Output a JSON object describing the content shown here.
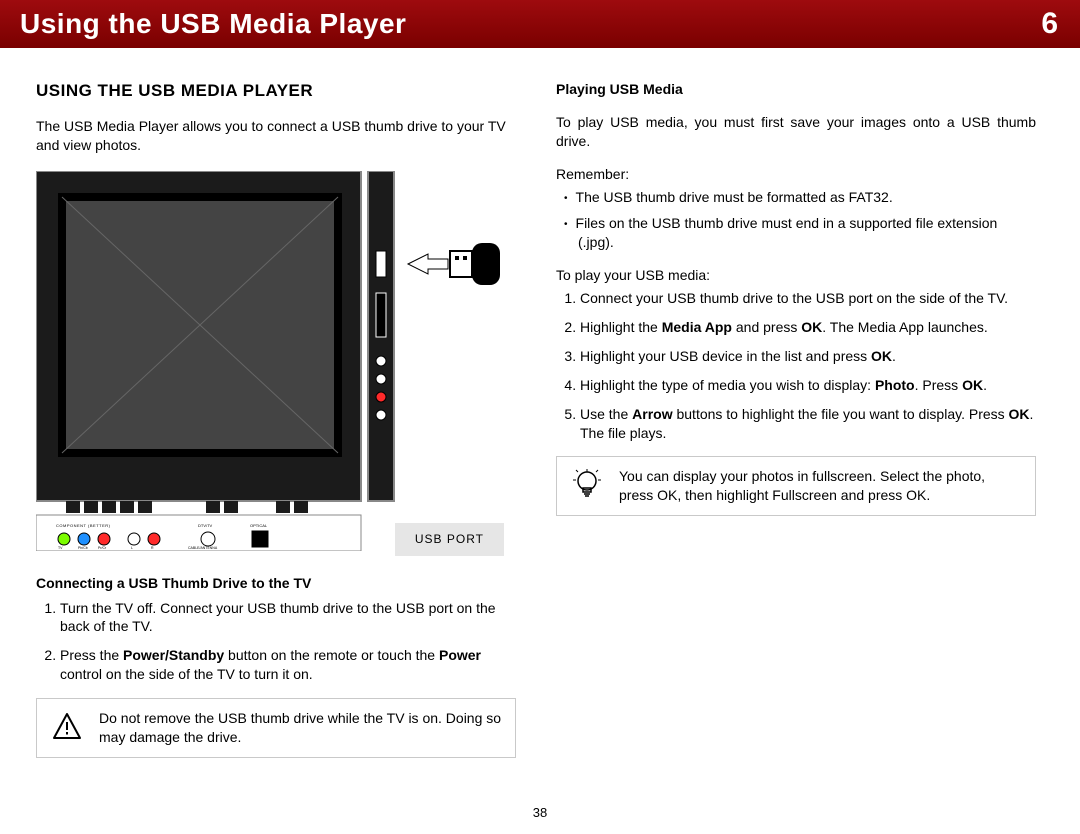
{
  "header": {
    "title": "Using the USB Media Player",
    "chapter": "6"
  },
  "left": {
    "section_title": "USING THE USB MEDIA PLAYER",
    "intro": "The USB Media Player allows you to connect a USB thumb drive to your TV and view photos.",
    "illustration_label": "USB PORT",
    "connect_heading": "Connecting a USB Thumb Drive to the TV",
    "connect_steps": [
      "Turn the TV off. Connect your USB thumb drive to the USB port on the back of the TV.",
      {
        "pre": "Press the ",
        "b1": "Power/Standby",
        "mid": " button on the remote or touch the ",
        "b2": "Power",
        "post": " control on the side of the TV to turn it on."
      }
    ],
    "warning_text": "Do not remove the USB thumb drive while the TV is on. Doing so may damage the drive."
  },
  "right": {
    "play_heading": "Playing USB Media",
    "play_intro": "To play USB media, you must first save your images onto a USB thumb drive.",
    "remember_label": "Remember:",
    "remember_items": [
      "The USB thumb drive must be formatted as FAT32.",
      "Files on the USB thumb drive must end in a supported file extension (.jpg)."
    ],
    "play_steps_label": "To play your USB media:",
    "play_steps": [
      "Connect your USB thumb drive to the USB port on the side of the TV.",
      {
        "pre": "Highlight the ",
        "b1": "Media App",
        "mid": " and press ",
        "b2": "OK",
        "post": ". The Media App launches."
      },
      {
        "pre": "Highlight your USB device in the list and press ",
        "b1": "OK",
        "post": "."
      },
      {
        "pre": "Highlight the type of media you wish to display: ",
        "b1": "Photo",
        "mid": ". Press ",
        "b2": "OK",
        "post": "."
      },
      {
        "pre": "Use the ",
        "b1": "Arrow",
        "mid": " buttons to highlight the file you want to display. Press ",
        "b2": "OK",
        "post": ". The file plays."
      }
    ],
    "tip_text": "You can display your photos in fullscreen. Select the photo, press OK, then highlight Fullscreen and press OK."
  },
  "page_number": "38",
  "tv_ports": {
    "component": "COMPONENT (BETTER)",
    "dtv": "DTV/TV",
    "optical": "OPTICAL",
    "tv": "TV",
    "pb": "Pb/Cb",
    "pr": "Pr/Cr",
    "l": "L",
    "r": "R",
    "cable": "CABLE/ANTENNA"
  }
}
